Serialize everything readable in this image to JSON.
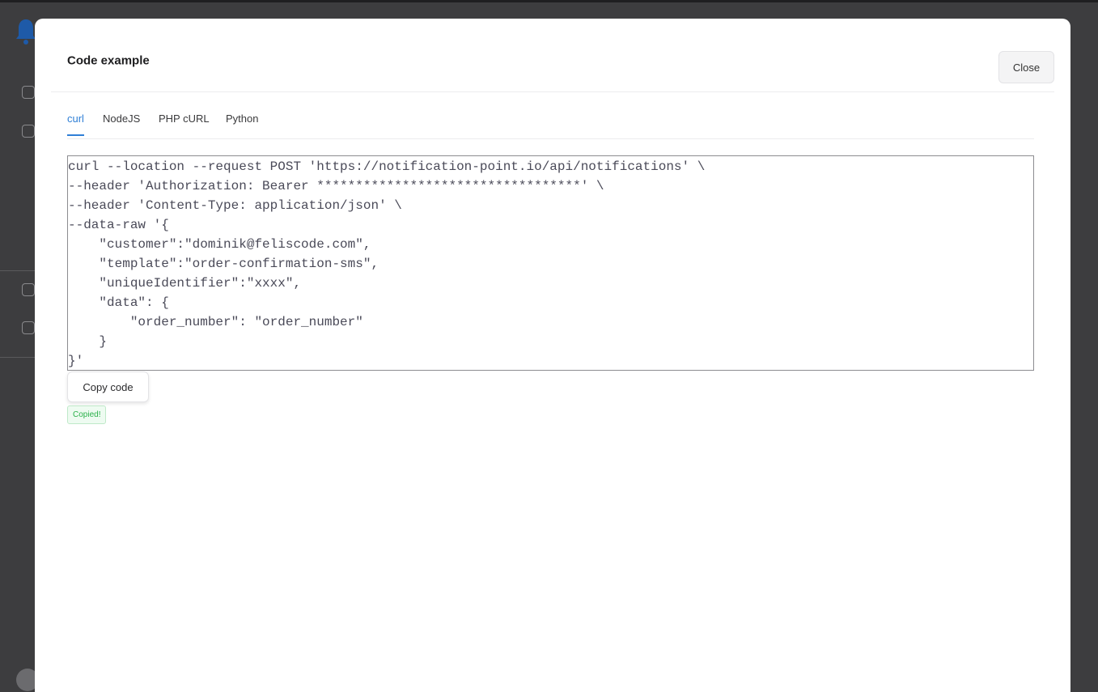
{
  "modal": {
    "title": "Code example",
    "close_label": "Close"
  },
  "tabs": [
    {
      "label": "curl",
      "active": true
    },
    {
      "label": "NodeJS",
      "active": false
    },
    {
      "label": "PHP cURL",
      "active": false
    },
    {
      "label": "Python",
      "active": false
    }
  ],
  "code": {
    "lines": [
      "curl --location --request POST 'https://notification-point.io/api/notifications' \\",
      "--header 'Authorization: Bearer **********************************' \\",
      "--header 'Content-Type: application/json' \\",
      "--data-raw '{",
      "    \"customer\":\"dominik@feliscode.com\",",
      "    \"template\":\"order-confirmation-sms\",",
      "    \"uniqueIdentifier\":\"xxxx\",",
      "    \"data\": {",
      "        \"order_number\": \"order_number\"",
      "    }",
      "}'"
    ],
    "copy_label": "Copy code",
    "copied_label": "Copied!"
  },
  "colors": {
    "accent": "#2f7fd6",
    "success": "#2bb14a",
    "overlay": "#3d3d3f"
  }
}
